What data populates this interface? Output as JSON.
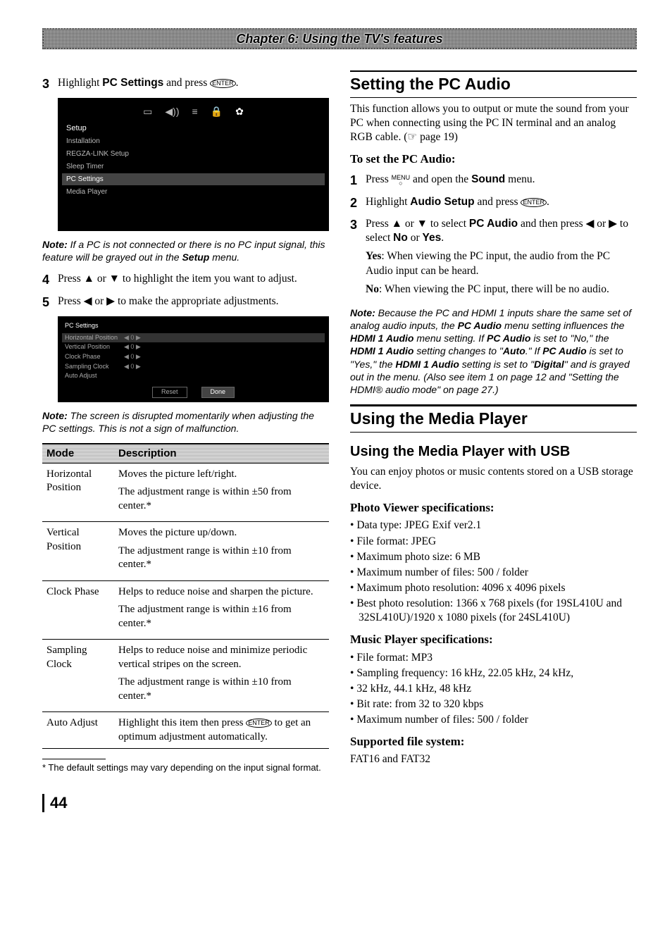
{
  "chapter": "Chapter 6: Using the TV's features",
  "pagenum": "44",
  "left": {
    "step3_pre": "Highlight ",
    "step3_bold": "PC Settings",
    "step3_post": " and press ",
    "enter": "ENTER",
    "ui1": {
      "setup": "Setup",
      "items": [
        "Installation",
        "REGZA-LINK Setup",
        "Sleep Timer",
        "PC Settings",
        "Media Player"
      ]
    },
    "note1_lead": "Note:",
    "note1_body": " If a PC is not connected or there is no PC input signal, this feature will be grayed out in the ",
    "note1_bold": "Setup",
    "note1_tail": " menu.",
    "step4": "Press ▲ or ▼ to highlight the item you want to adjust.",
    "step5": "Press ◀ or ▶ to make the appropriate adjustments.",
    "ui2": {
      "title": "PC Settings",
      "rows": [
        "Horizontal Position",
        "Vertical Position",
        "Clock Phase",
        "Sampling Clock",
        "Auto Adjust"
      ],
      "arrows": "◀   0   ▶",
      "reset": "Reset",
      "done": "Done"
    },
    "note2_lead": "Note:",
    "note2_body": " The screen is disrupted momentarily when adjusting the PC settings. This is not a sign of malfunction.",
    "table": {
      "h1": "Mode",
      "h2": "Description",
      "rows": [
        {
          "m": "Horizontal Position",
          "d1": "Moves the picture left/right.",
          "d2": "The adjustment range is within ±50 from center.*"
        },
        {
          "m": "Vertical Position",
          "d1": "Moves the picture up/down.",
          "d2": "The adjustment range is within ±10 from center.*"
        },
        {
          "m": "Clock Phase",
          "d1": "Helps to reduce noise and sharpen the picture.",
          "d2": "The adjustment range is within ±16 from center.*"
        },
        {
          "m": "Sampling Clock",
          "d1": "Helps to reduce noise and minimize periodic vertical stripes on the screen.",
          "d2": "The adjustment range is within ±10 from center.*"
        },
        {
          "m": "Auto Adjust",
          "d1": "Highlight this item then press ",
          "d1_btn": "ENTER",
          "d1_tail": " to get an optimum adjustment automatically.",
          "d2": ""
        }
      ]
    },
    "footnote": "* The default settings may vary depending on the input signal format."
  },
  "right": {
    "h_audio": "Setting the PC Audio",
    "p_audio": "This function allows you to output or mute the sound from your PC when connecting using the PC IN terminal and an analog RGB cable. (☞ page 19)",
    "h_toset": "To set the PC Audio:",
    "s1a": "Press ",
    "menu": "MENU",
    "s1b": " and open the ",
    "s1_bold": "Sound",
    "s1c": " menu.",
    "s2a": "Highlight ",
    "s2_bold": "Audio Setup",
    "s2b": " and press ",
    "s3a": "Press ▲ or ▼ to select ",
    "s3_bold1": "PC Audio",
    "s3b": " and then press ◀ or ▶ to select ",
    "s3_bold2": "No",
    "s3_or": " or ",
    "s3_bold3": "Yes",
    "s3_dot": ".",
    "yes_lbl": "Yes",
    "yes_txt": ": When viewing the PC input, the audio from the PC Audio input can be heard.",
    "no_lbl": "No",
    "no_txt": ": When viewing the PC input, there will be no audio.",
    "note3_lead": "Note:",
    "note3": " Because the PC and HDMI 1 inputs share the same set of analog audio inputs, the ",
    "note3_b1": "PC Audio",
    "note3_t1": " menu setting influences the ",
    "note3_b2": "HDMI 1 Audio",
    "note3_t2": " menu setting. If ",
    "note3_b3": "PC Audio",
    "note3_t3": " is set to \"No,\" the ",
    "note3_b4": "HDMI 1 Audio",
    "note3_t4": " setting changes to \"",
    "note3_b5": "Auto",
    "note3_t5": ".\" If ",
    "note3_b6": "PC Audio",
    "note3_t6": " is set to \"Yes,\" the ",
    "note3_b7": "HDMI 1 Audio",
    "note3_t7": " setting is set to \"",
    "note3_b8": "Digital",
    "note3_t8": "\" and is grayed out in the menu. (Also see item 1 on page 12 and \"Setting the HDMI® audio mode\" on page 27.)",
    "h_media": "Using the Media Player",
    "h_media_usb": "Using the Media Player with USB",
    "p_media": "You can enjoy photos or music contents stored on a USB storage device.",
    "h_photo": "Photo Viewer specifications:",
    "photo_bullets": [
      "Data type: JPEG Exif ver2.1",
      "File format: JPEG",
      "Maximum photo size: 6 MB",
      "Maximum number of files: 500 / folder",
      "Maximum photo resolution: 4096 x 4096 pixels",
      "Best photo resolution: 1366 x 768 pixels (for 19SL410U and 32SL410U)/1920 x 1080 pixels (for 24SL410U)"
    ],
    "h_music": "Music Player specifications:",
    "music_bullets": [
      "File format: MP3",
      "Sampling frequency: 16 kHz, 22.05 kHz, 24 kHz,",
      "32 kHz, 44.1 kHz, 48 kHz",
      "Bit rate: from 32 to 320 kbps",
      "Maximum number of files: 500 / folder"
    ],
    "h_fs": "Supported file system:",
    "p_fs": "FAT16 and FAT32"
  }
}
